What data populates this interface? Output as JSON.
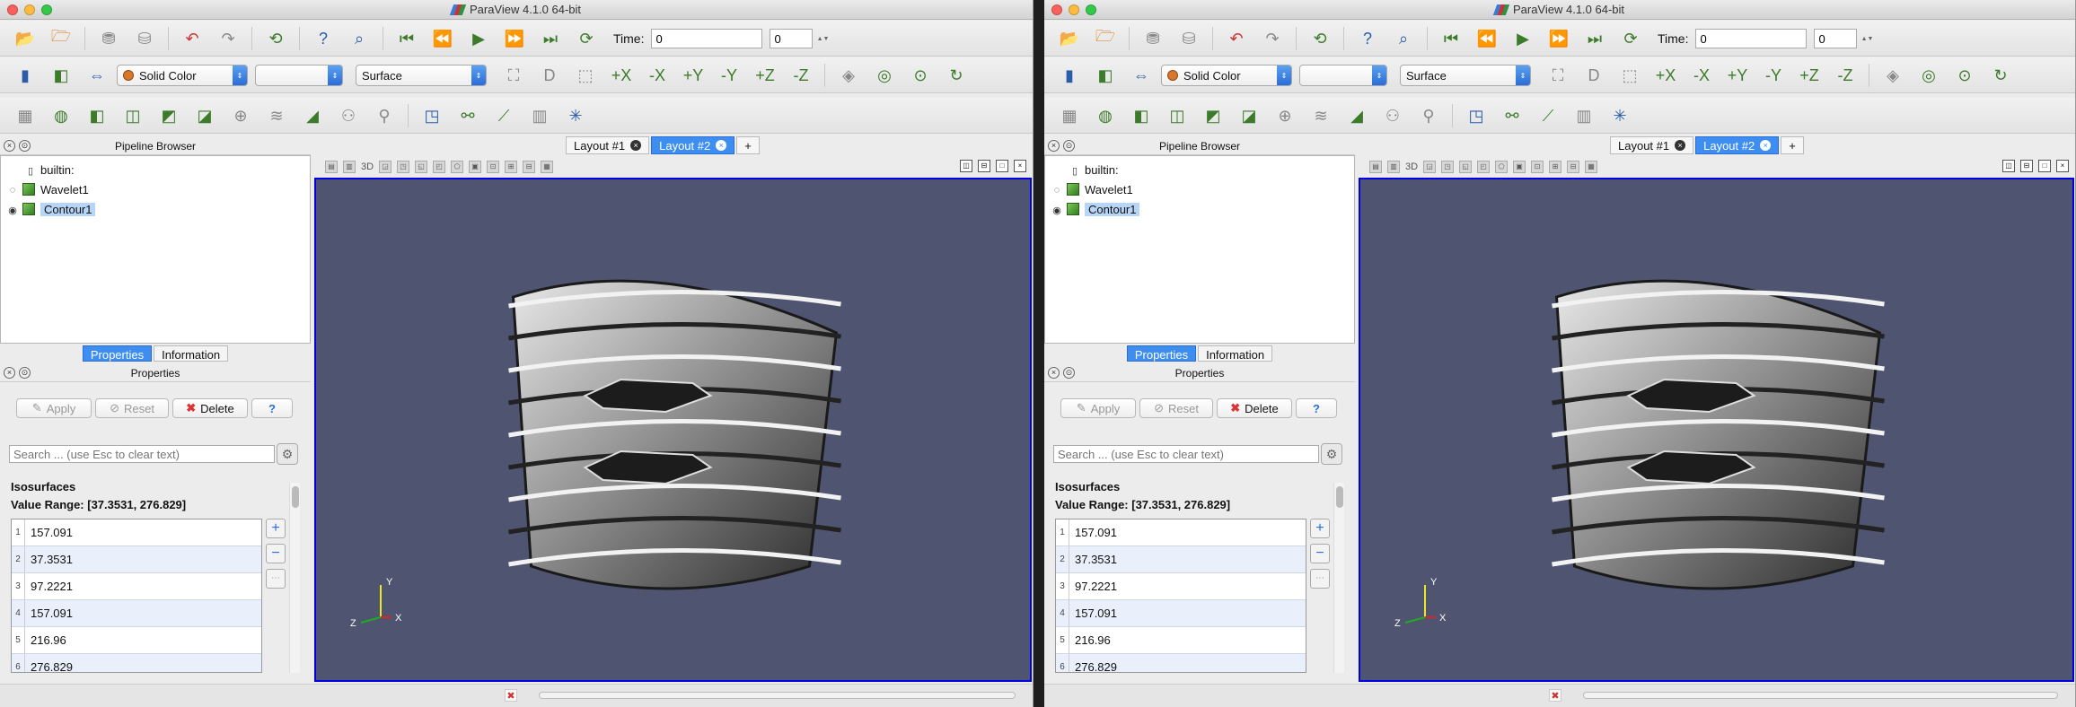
{
  "windows": [
    {
      "id": "left",
      "title": "ParaView 4.1.0 64-bit",
      "toolbar": {
        "time_label": "Time:",
        "time_value": "0",
        "time_step": "0",
        "color_by": "Solid Color",
        "color_component": "",
        "representation": "Surface"
      },
      "pipeline": {
        "header": "Pipeline Browser",
        "items": [
          "builtin:",
          "Wavelet1",
          "Contour1"
        ]
      },
      "tabs": {
        "properties": "Properties",
        "information": "Information"
      },
      "properties": {
        "header": "Properties",
        "apply": "Apply",
        "reset": "Reset",
        "delete": "Delete",
        "help": "?",
        "search_placeholder": "Search ... (use Esc to clear text)",
        "isosurfaces_title": "Isosurfaces",
        "value_range": "Value Range: [37.3531, 276.829]",
        "iso_values": [
          "157.091",
          "37.3531",
          "97.2221",
          "157.091",
          "216.96",
          "276.829"
        ]
      },
      "layout": {
        "tab1": "Layout #1",
        "tab2": "Layout #2",
        "add": "+",
        "mode_3d": "3D"
      },
      "axes": {
        "x": "X",
        "y": "Y",
        "z": "Z"
      }
    },
    {
      "id": "right",
      "title": "ParaView 4.1.0 64-bit",
      "toolbar": {
        "time_label": "Time:",
        "time_value": "0",
        "time_step": "0",
        "color_by": "Solid Color",
        "color_component": "",
        "representation": "Surface"
      },
      "pipeline": {
        "header": "Pipeline Browser",
        "items": [
          "builtin:",
          "Wavelet1",
          "Contour1"
        ]
      },
      "tabs": {
        "properties": "Properties",
        "information": "Information"
      },
      "properties": {
        "header": "Properties",
        "apply": "Apply",
        "reset": "Reset",
        "delete": "Delete",
        "help": "?",
        "search_placeholder": "Search ... (use Esc to clear text)",
        "isosurfaces_title": "Isosurfaces",
        "value_range": "Value Range: [37.3531, 276.829]",
        "iso_values": [
          "157.091",
          "37.3531",
          "97.2221",
          "157.091",
          "216.96",
          "276.829"
        ]
      },
      "layout": {
        "tab1": "Layout #1",
        "tab2": "Layout #2",
        "add": "+",
        "mode_3d": "3D"
      },
      "axes": {
        "x": "X",
        "y": "Y",
        "z": "Z"
      }
    }
  ],
  "colors": {
    "viewport_bg": "#4f5470",
    "accent": "#3d8ef0",
    "active_view_border": "#0000e6"
  }
}
